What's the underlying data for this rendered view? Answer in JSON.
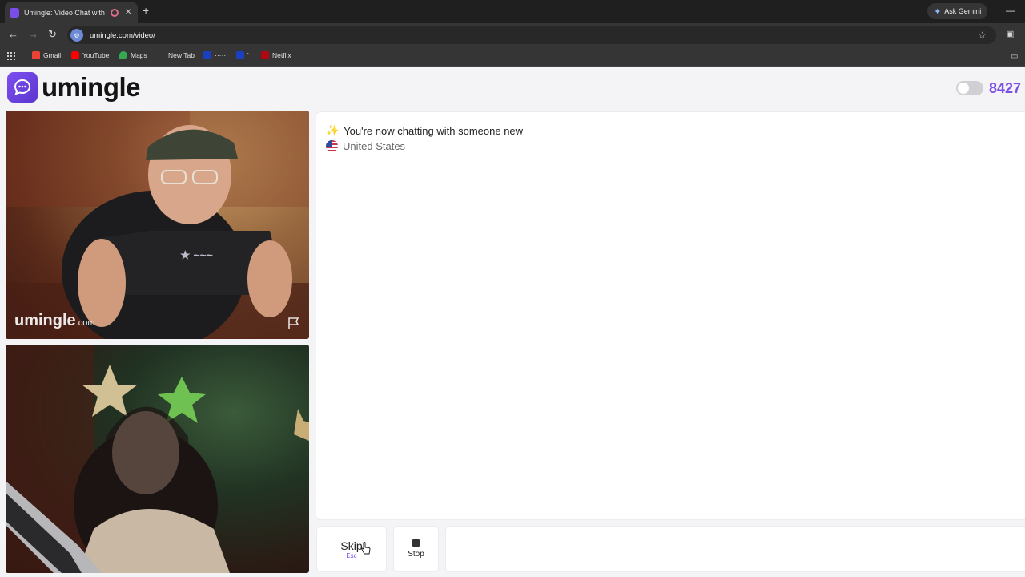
{
  "browser": {
    "tab_title": "Umingle: Video Chat with S",
    "url": "umingle.com/video/",
    "ask_gemini_label": "Ask Gemini",
    "bookmarks": [
      {
        "label": "Gmail",
        "color": "#ea4335"
      },
      {
        "label": "YouTube",
        "color": "#ff0000"
      },
      {
        "label": "Maps",
        "color": "#34a853"
      },
      {
        "label": "New Tab",
        "color": ""
      },
      {
        "label": "······",
        "color": "#1a3fbf"
      },
      {
        "label": "'",
        "color": "#1a3fbf"
      },
      {
        "label": "Netflix",
        "color": "#b00710"
      }
    ]
  },
  "site": {
    "logo_text": "umingle",
    "online_count": "8427",
    "watermark_main": "umingle",
    "watermark_suffix": ".com",
    "accent_color": "#7c4fe6"
  },
  "chat": {
    "status_message": "You're now chatting with someone new",
    "partner_country": "United States"
  },
  "controls": {
    "skip_label": "Skip",
    "skip_hint": "Esc",
    "stop_label": "Stop"
  }
}
